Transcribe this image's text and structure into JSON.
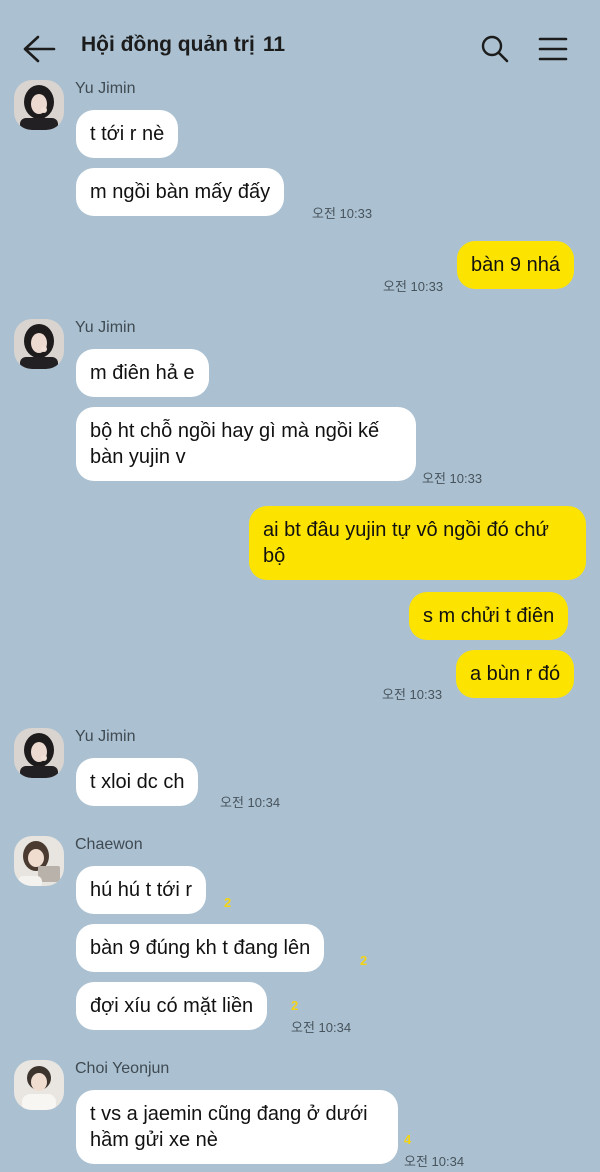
{
  "header": {
    "title": "Hội đồng quản trị",
    "member_count": "11",
    "back_icon": "arrow-left-icon",
    "search_icon": "search-icon",
    "menu_icon": "menu-icon"
  },
  "senders": {
    "jimin": "Yu Jimin",
    "chaewon": "Chaewon",
    "yeonjun": "Choi Yeonjun"
  },
  "messages": [
    {
      "id": "m1",
      "text": "t tới r nè"
    },
    {
      "id": "m2",
      "text": "m ngồi bàn mấy đấy",
      "time": "오전 10:33"
    },
    {
      "id": "m3",
      "text": "bàn 9 nhá",
      "time": "오전 10:33"
    },
    {
      "id": "m4",
      "text": "m điên hả e"
    },
    {
      "id": "m5",
      "text": "bộ ht chỗ ngồi hay gì mà ngồi kế bàn yujin v",
      "time": "오전 10:33"
    },
    {
      "id": "m6",
      "text": "ai bt đâu yujin tự vô ngồi đó chứ bộ"
    },
    {
      "id": "m7",
      "text": "s m chửi t điên"
    },
    {
      "id": "m8",
      "text": "a bùn r đó",
      "time": "오전 10:33"
    },
    {
      "id": "m9",
      "text": "t xloi dc ch",
      "time": "오전 10:34"
    },
    {
      "id": "m10",
      "text": "hú hú t tới r",
      "unread": "2"
    },
    {
      "id": "m11",
      "text": "bàn 9 đúng kh t đang lên",
      "unread": "2"
    },
    {
      "id": "m12",
      "text": "đợi xíu có mặt liền",
      "unread": "2",
      "time": "오전 10:34"
    },
    {
      "id": "m13",
      "text": "t vs a jaemin cũng đang ở dưới hầm gửi xe nè",
      "unread": "4",
      "time": "오전 10:34"
    }
  ],
  "colors": {
    "background": "#abc1d1",
    "incoming_bubble": "#ffffff",
    "outgoing_bubble": "#fde300",
    "unread_count": "#f3d414"
  }
}
